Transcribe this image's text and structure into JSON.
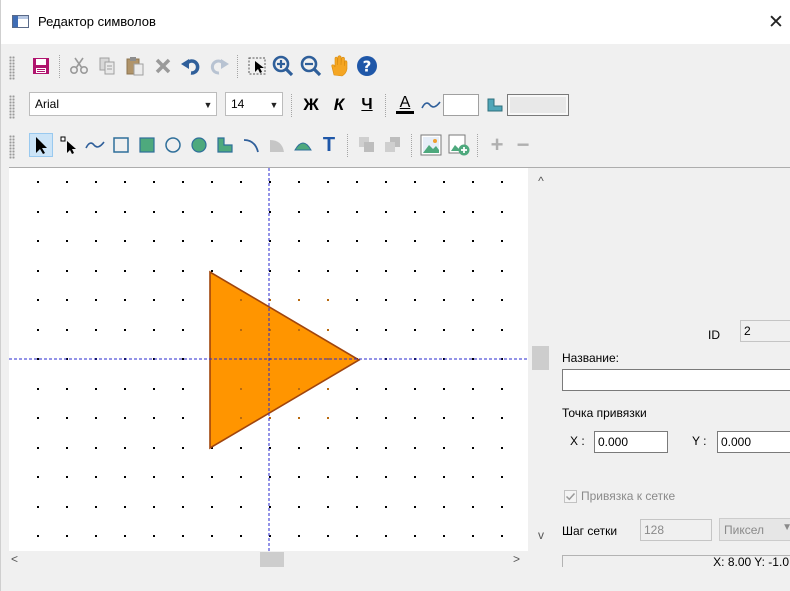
{
  "window": {
    "title": "Редактор символов",
    "close_glyph": "✕"
  },
  "toolbar_main": {
    "buttons": [
      {
        "name": "save",
        "icon": "save-icon"
      },
      {
        "name": "cut",
        "icon": "scissors-icon"
      },
      {
        "name": "copy",
        "icon": "copy-icon"
      },
      {
        "name": "paste",
        "icon": "paste-icon"
      },
      {
        "name": "delete",
        "icon": "delete-x-icon"
      },
      {
        "name": "undo",
        "icon": "undo-icon"
      },
      {
        "name": "redo",
        "icon": "redo-icon"
      },
      {
        "name": "select-region",
        "icon": "select-region-icon"
      },
      {
        "name": "zoom-in",
        "icon": "zoom-in-icon"
      },
      {
        "name": "zoom-out",
        "icon": "zoom-out-icon"
      },
      {
        "name": "pan",
        "icon": "hand-icon"
      },
      {
        "name": "help",
        "icon": "help-icon"
      }
    ]
  },
  "toolbar_format": {
    "font_name": "Arial",
    "font_size": "14",
    "bold_label": "Ж",
    "italic_label": "К",
    "underline_label": "Ч",
    "font_color_label": "A",
    "font_color": "#000000",
    "line_color_icon": "line-color-icon",
    "fill_color_icon": "fill-color-icon"
  },
  "toolbar_draw": {
    "text_tool_label": "T",
    "add_label": "+",
    "remove_label": "−",
    "tools": [
      {
        "name": "pointer",
        "icon": "pointer-icon",
        "active": true
      },
      {
        "name": "node-edit",
        "icon": "node-pointer-icon"
      },
      {
        "name": "polyline",
        "icon": "polyline-icon"
      },
      {
        "name": "rectangle",
        "icon": "rectangle-icon"
      },
      {
        "name": "filled-rectangle",
        "icon": "filled-rectangle-icon"
      },
      {
        "name": "ellipse",
        "icon": "ellipse-icon"
      },
      {
        "name": "filled-ellipse",
        "icon": "filled-ellipse-icon"
      },
      {
        "name": "polygon",
        "icon": "polygon-icon"
      },
      {
        "name": "arc",
        "icon": "arc-icon"
      },
      {
        "name": "pie",
        "icon": "pie-icon"
      },
      {
        "name": "chord",
        "icon": "chord-icon"
      },
      {
        "name": "text",
        "icon": "text-icon"
      },
      {
        "name": "bring-front",
        "icon": "bring-front-icon"
      },
      {
        "name": "send-back",
        "icon": "send-back-icon"
      },
      {
        "name": "image",
        "icon": "image-icon"
      },
      {
        "name": "add-image",
        "icon": "add-image-icon"
      },
      {
        "name": "add",
        "icon": "plus-icon"
      },
      {
        "name": "remove",
        "icon": "minus-icon"
      }
    ]
  },
  "canvas": {
    "shape": "triangle",
    "shape_fill": "#ff9500",
    "shape_stroke": "#a0450d",
    "guide_color": "#2a2ad0",
    "grid_dot_color": "#000000"
  },
  "scroll": {
    "up": "^",
    "down": "v",
    "left": "<",
    "right": ">"
  },
  "panel": {
    "id_label": "ID",
    "id_value": "2",
    "name_label": "Название:",
    "name_value": "",
    "anchor_label": "Точка привязки",
    "x_label": "X :",
    "x_value": "0.000",
    "y_label": "Y :",
    "y_value": "0.000",
    "snap_label": "Привязка к сетке",
    "snap_checked": true,
    "grid_step_label": "Шаг сетки",
    "grid_step_value": "128",
    "unit_value": "Пиксел",
    "status_text": "X: 8.00  Y: -1.0"
  }
}
